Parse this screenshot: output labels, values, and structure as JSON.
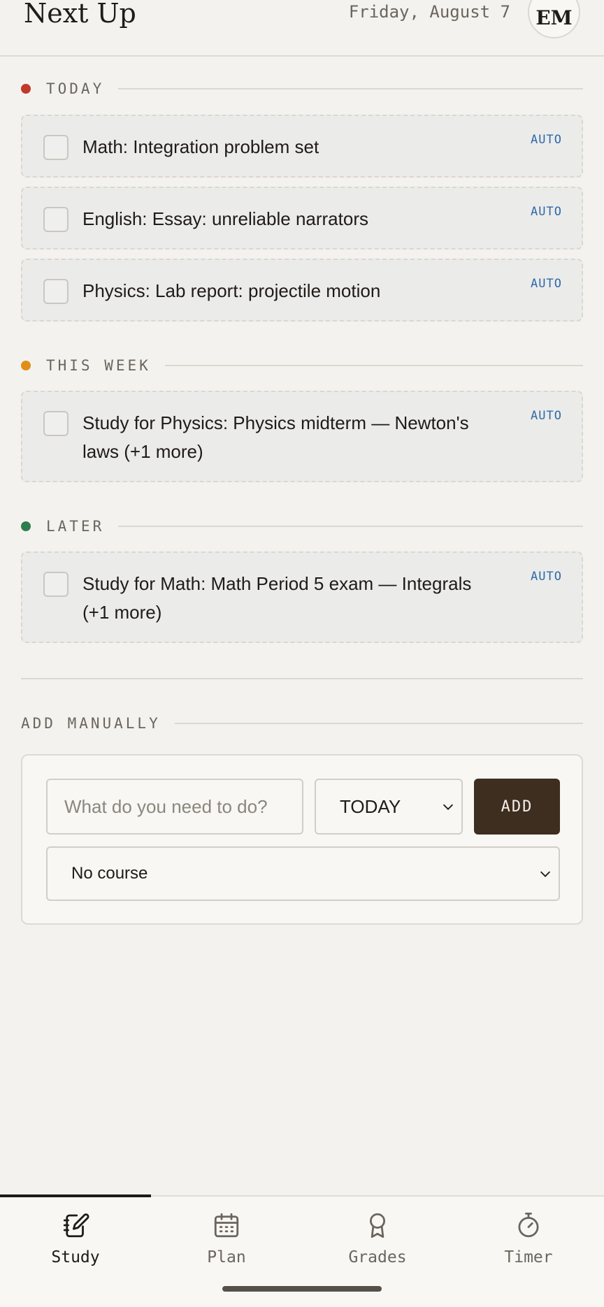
{
  "header": {
    "title": "Next Up",
    "date": "Friday, August 7",
    "avatar_initials": "EM"
  },
  "sections": [
    {
      "label": "TODAY",
      "color": "#c0392b",
      "tasks": [
        {
          "text": "Math: Integration problem set",
          "badge": "AUTO"
        },
        {
          "text": "English: Essay: unreliable narrators",
          "badge": "AUTO"
        },
        {
          "text": "Physics: Lab report: projectile motion",
          "badge": "AUTO"
        }
      ]
    },
    {
      "label": "THIS WEEK",
      "color": "#e08e1b",
      "tasks": [
        {
          "text": "Study for Physics: Physics midterm — Newton's laws (+1 more)",
          "badge": "AUTO"
        }
      ]
    },
    {
      "label": "LATER",
      "color": "#2e7d4f",
      "tasks": [
        {
          "text": "Study for Math: Math Period 5 exam — Integrals (+1 more)",
          "badge": "AUTO"
        }
      ]
    }
  ],
  "add_manually": {
    "label": "ADD MANUALLY",
    "input_placeholder": "What do you need to do?",
    "input_value": "",
    "when_selected": "TODAY",
    "add_button": "ADD",
    "course_selected": "No course"
  },
  "nav": {
    "active": "Study",
    "items": [
      {
        "label": "Study",
        "icon": "notebook-pencil-icon"
      },
      {
        "label": "Plan",
        "icon": "calendar-icon"
      },
      {
        "label": "Grades",
        "icon": "award-ribbon-icon"
      },
      {
        "label": "Timer",
        "icon": "stopwatch-icon"
      }
    ]
  },
  "colors": {
    "background": "#f4f2ee",
    "accent_dark": "#3e2e20",
    "badge_blue": "#2f6aa8"
  }
}
